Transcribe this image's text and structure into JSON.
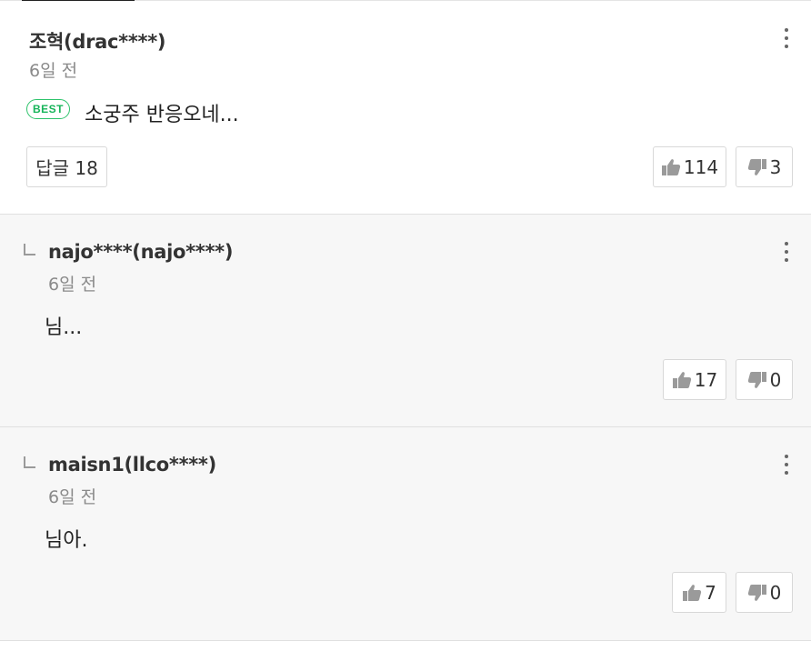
{
  "comments": [
    {
      "author": "조혁(drac****)",
      "time": "6일 전",
      "badge": "BEST",
      "text": "소궁주 반응오네...",
      "reply_button": "답글 18",
      "likes": "114",
      "dislikes": "3"
    },
    {
      "author": "najo****(najo****)",
      "time": "6일 전",
      "text": "님...",
      "likes": "17",
      "dislikes": "0"
    },
    {
      "author": "maisn1(llco****)",
      "time": "6일 전",
      "text": "님아.",
      "likes": "7",
      "dislikes": "0"
    }
  ],
  "colors": {
    "best": "#2ec36b",
    "reply_bg": "#f7f7f7",
    "icon": "#9a9a9a"
  },
  "icons": {
    "like": "thumbs-up-icon",
    "dislike": "thumbs-down-icon",
    "more": "more-vertical-icon",
    "reply": "reply-arrow-icon"
  }
}
